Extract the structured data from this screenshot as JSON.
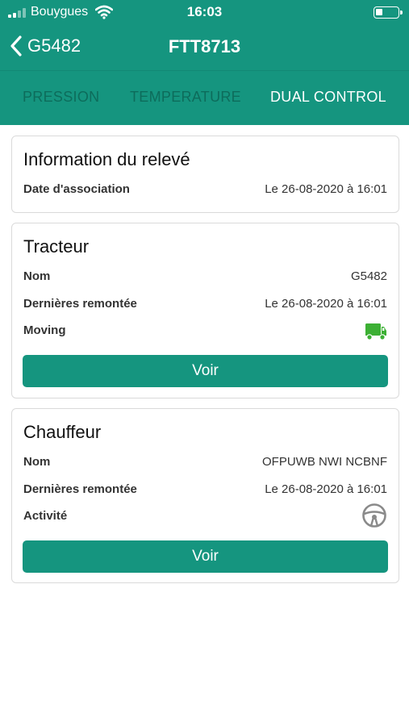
{
  "status_bar": {
    "carrier": "Bouygues",
    "time": "16:03"
  },
  "nav": {
    "back_label": "G5482",
    "title": "FTT8713"
  },
  "tabs": [
    {
      "label": "PRESSION",
      "active": false
    },
    {
      "label": "TEMPERATURE",
      "active": false
    },
    {
      "label": "DUAL CONTROL",
      "active": true
    }
  ],
  "info_card": {
    "title": "Information du relevé",
    "rows": [
      {
        "label": "Date d'association",
        "value": "Le 26-08-2020 à 16:01"
      }
    ]
  },
  "tracteur_card": {
    "title": "Tracteur",
    "rows": [
      {
        "label": "Nom",
        "value": "G5482"
      },
      {
        "label": "Dernières remontée",
        "value": "Le 26-08-2020 à 16:01"
      },
      {
        "label": "Moving",
        "icon": "truck-icon"
      }
    ],
    "button_label": "Voir"
  },
  "chauffeur_card": {
    "title": "Chauffeur",
    "rows": [
      {
        "label": "Nom",
        "value": "OFPUWB NWI NCBNF"
      },
      {
        "label": "Dernières remontée",
        "value": "Le 26-08-2020 à 16:01"
      },
      {
        "label": "Activité",
        "icon": "steering-wheel-icon"
      }
    ],
    "button_label": "Voir"
  },
  "colors": {
    "header": "#15957f",
    "button": "#15957f",
    "tab_inactive": "#0d6c5b",
    "truck_icon": "#3cb034",
    "wheel_icon": "#8a8a8a"
  }
}
